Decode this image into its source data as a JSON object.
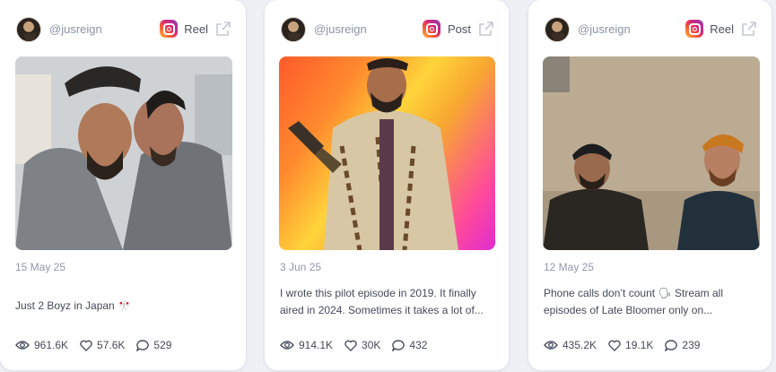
{
  "cards": [
    {
      "handle": "@jusreign",
      "post_type": "Reel",
      "date": "15 May 25",
      "caption": "Just 2 Boyz in Japan 🎌",
      "views": "961.6K",
      "likes": "57.6K",
      "comments": "529"
    },
    {
      "handle": "@jusreign",
      "post_type": "Post",
      "date": "3 Jun 25",
      "caption": "I wrote this pilot episode in 2019. It finally aired in 2024. Sometimes it takes a lot of...",
      "views": "914.1K",
      "likes": "30K",
      "comments": "432"
    },
    {
      "handle": "@jusreign",
      "post_type": "Reel",
      "date": "12 May 25",
      "caption": "Phone calls don’t count 🗣 Stream all episodes of Late Bloomer only on...",
      "views": "435.2K",
      "likes": "19.1K",
      "comments": "239"
    }
  ],
  "icons": {
    "platform": "instagram-icon",
    "open": "external-link-icon",
    "views": "eye-icon",
    "likes": "heart-icon",
    "comments": "comment-icon"
  }
}
